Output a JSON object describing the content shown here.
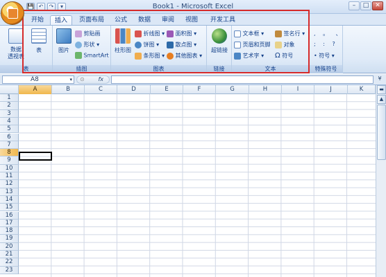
{
  "window": {
    "title": "Book1 - Microsoft Excel",
    "min": "–",
    "max": "□",
    "close": "✕"
  },
  "qat": {
    "save": "💾",
    "undo": "↶",
    "redo": "↷",
    "custom": "▾"
  },
  "tabs": [
    {
      "label": "开始"
    },
    {
      "label": "插入"
    },
    {
      "label": "页面布局"
    },
    {
      "label": "公式"
    },
    {
      "label": "数据"
    },
    {
      "label": "审阅"
    },
    {
      "label": "视图"
    },
    {
      "label": "开发工具"
    }
  ],
  "ribbon": {
    "groups": {
      "tables": {
        "label": "表",
        "pivot": "数据\n透视表",
        "table": "表"
      },
      "illustrations": {
        "label": "插图",
        "picture": "图片",
        "clipart": "剪贴画",
        "shapes": "形状",
        "smartart": "SmartArt"
      },
      "charts": {
        "label": "图表",
        "column": "柱形图",
        "line": "折线图",
        "pie": "饼图",
        "bar": "条形图",
        "area": "面积图",
        "scatter": "散点图",
        "other": "其他图表"
      },
      "links": {
        "label": "链接",
        "hyperlink": "超链接"
      },
      "text": {
        "label": "文本",
        "textbox": "文本框",
        "headerfooter": "页眉和页脚",
        "wordart": "艺术字",
        "signature": "签名行",
        "object": "对象",
        "symbol": "符号"
      },
      "special": {
        "label": "特殊符号",
        "symbol": "符号"
      }
    }
  },
  "formula_bar": {
    "namebox": "A8",
    "fx": "fx"
  },
  "columns": [
    "A",
    "B",
    "C",
    "D",
    "E",
    "F",
    "G",
    "H",
    "I",
    "J",
    "K"
  ],
  "rows": [
    "1",
    "2",
    "3",
    "4",
    "5",
    "6",
    "7",
    "8",
    "9",
    "10",
    "11",
    "12",
    "13",
    "14",
    "15",
    "16",
    "17",
    "18",
    "19",
    "20",
    "21",
    "22",
    "23"
  ],
  "active_cell": "A8",
  "colors": {
    "highlight": "#d62a2a",
    "selected_header": "#f0b74c"
  }
}
